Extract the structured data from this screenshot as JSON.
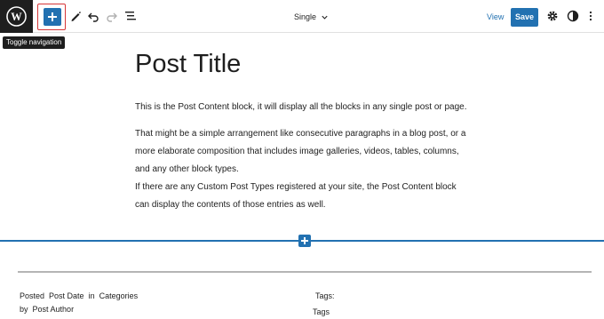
{
  "topbar": {
    "tooltip": "Toggle navigation",
    "template_name": "Single",
    "view_label": "View",
    "save_label": "Save"
  },
  "post": {
    "title": "Post Title",
    "paragraphs": [
      "This is the Post Content block, it will display all the blocks in any single post or page.",
      "That might be a simple arrangement like consecutive paragraphs in a blog post, or a more elaborate composition that includes image galleries, videos, tables, columns, and any other block types.",
      "If there are any Custom Post Types registered at your site, the Post Content block can display the contents of those entries as well."
    ]
  },
  "meta": {
    "posted": "Posted",
    "post_date": "Post Date",
    "in": "in",
    "categories": "Categories",
    "by": "by",
    "post_author": "Post Author",
    "tags_label": "Tags:",
    "tags": "Tags"
  },
  "colors": {
    "accent": "#2271b1",
    "highlight_border": "#d63638",
    "logo_bg": "#1e1e1e"
  }
}
